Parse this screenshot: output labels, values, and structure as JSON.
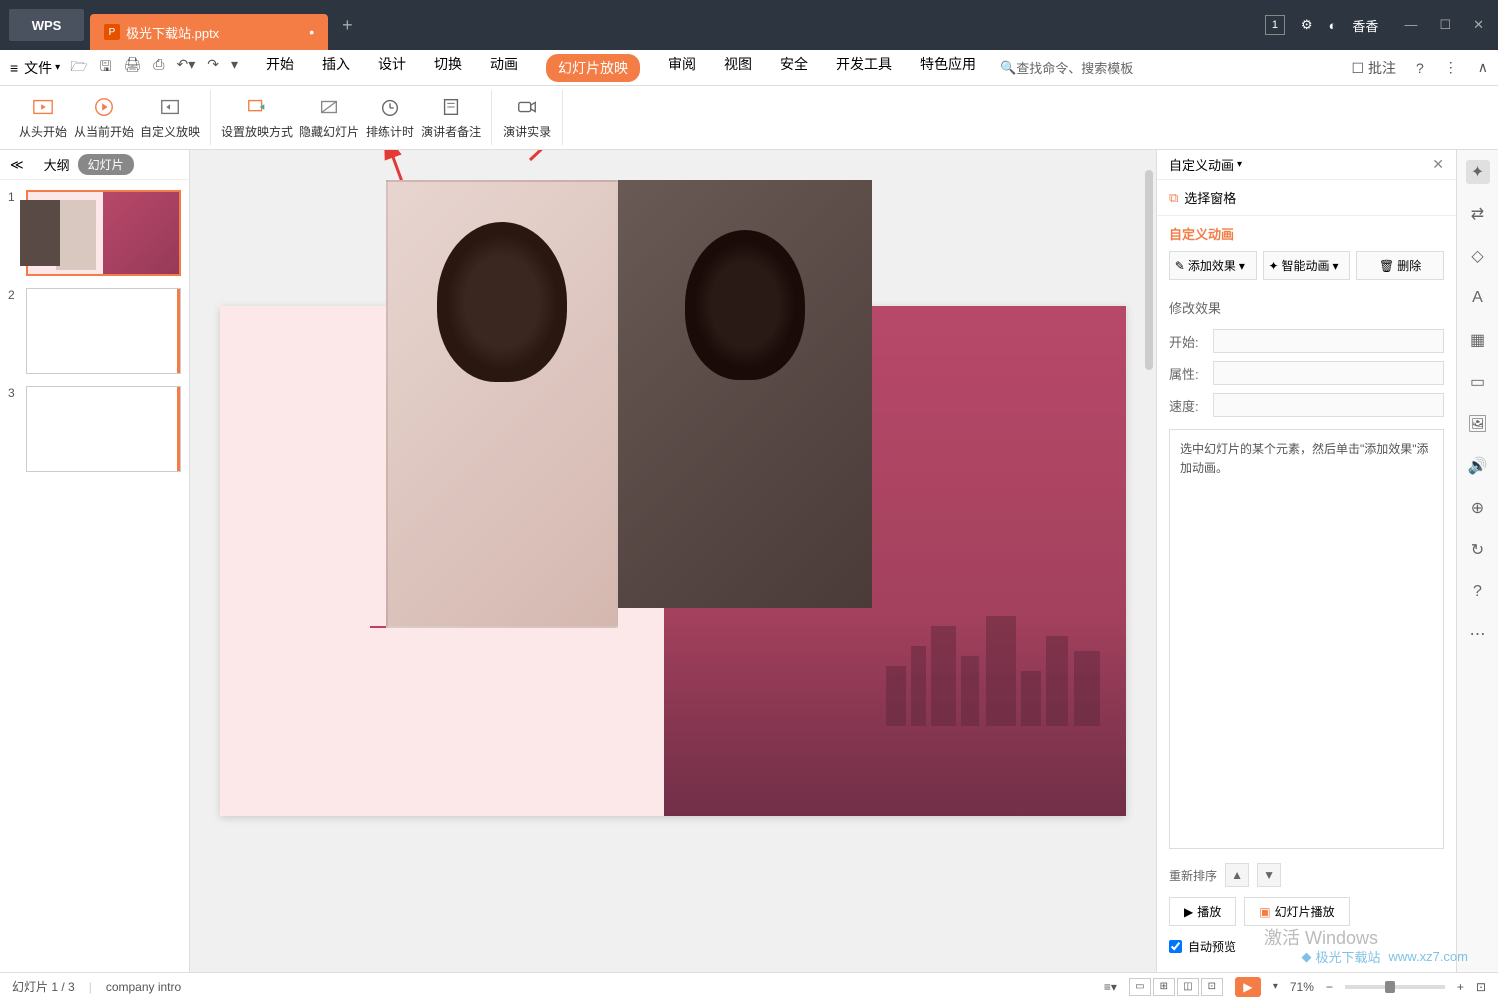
{
  "title_bar": {
    "app": "WPS",
    "tab_name": "极光下载站.pptx",
    "badge": "1",
    "user": "香香"
  },
  "menu": {
    "file": "文件",
    "tabs": [
      "开始",
      "插入",
      "设计",
      "切换",
      "动画",
      "幻灯片放映",
      "审阅",
      "视图",
      "安全",
      "开发工具",
      "特色应用"
    ],
    "active_tab": "幻灯片放映",
    "search": "查找命令、搜索模板",
    "comment": "批注"
  },
  "ribbon": {
    "from_begin": "从头开始",
    "from_current": "从当前开始",
    "custom_show": "自定义放映",
    "setup_show": "设置放映方式",
    "hide_slide": "隐藏幻灯片",
    "rehearse": "排练计时",
    "notes": "演讲者备注",
    "record": "演讲实录"
  },
  "slide_panel": {
    "outline": "大纲",
    "slide": "幻灯片",
    "nums": [
      "1",
      "2",
      "3"
    ]
  },
  "right_panel": {
    "title": "自定义动画",
    "select_pane": "选择窗格",
    "custom_anim": "自定义动画",
    "add_effect": "添加效果",
    "smart_anim": "智能动画",
    "delete": "删除",
    "modify": "修改效果",
    "start": "开始:",
    "property": "属性:",
    "speed": "速度:",
    "hint": "选中幻灯片的某个元素，然后单击\"添加效果\"添加动画。",
    "reorder": "重新排序",
    "play": "播放",
    "slide_show": "幻灯片播放",
    "auto_preview": "自动预览"
  },
  "status": {
    "slide_pos": "幻灯片 1 / 3",
    "template": "company intro",
    "zoom": "71%"
  },
  "activate": "激活 Windows",
  "watermark_site": "极光下载站",
  "watermark_url": "www.xz7.com"
}
